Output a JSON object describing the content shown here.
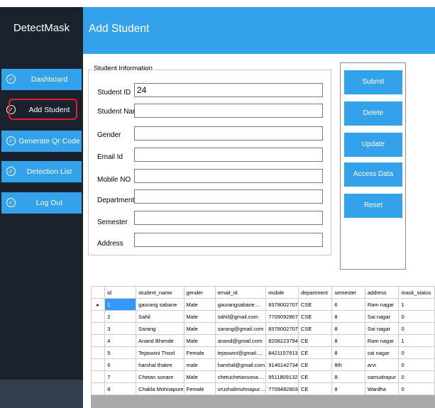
{
  "app": {
    "brand": "DetectMask",
    "page_title": "Add Student"
  },
  "sidebar": {
    "items": [
      {
        "label": "Dashboard",
        "icon": "check-circle-icon"
      },
      {
        "label": "Add Student",
        "icon": "check-circle-icon"
      },
      {
        "label": "Generate Qr Code",
        "icon": "check-circle-icon"
      },
      {
        "label": "Detection List",
        "icon": "check-circle-icon"
      },
      {
        "label": "Log Out",
        "icon": "check-circle-icon"
      }
    ],
    "active": "Add Student",
    "accent": "#33a2ea",
    "highlight_ring": "#e0212c"
  },
  "form": {
    "group_title": "Student Information",
    "fields": [
      {
        "label": "Student ID",
        "value": "24"
      },
      {
        "label": "Student Name",
        "value": ""
      },
      {
        "label": "Gender",
        "value": ""
      },
      {
        "label": "Email Id",
        "value": ""
      },
      {
        "label": "Mobile NO",
        "value": ""
      },
      {
        "label": "Department",
        "value": ""
      },
      {
        "label": "Semester",
        "value": ""
      },
      {
        "label": "Address",
        "value": ""
      }
    ]
  },
  "actions": {
    "submit": "Submit",
    "delete": "Delete",
    "update": "Update",
    "access": "Access Data",
    "reset": "Reset"
  },
  "grid": {
    "row_marker": "▸",
    "columns": [
      "id",
      "student_name",
      "gender",
      "email_id",
      "mobile",
      "department",
      "semester",
      "address",
      "mask_status"
    ],
    "rows": [
      [
        "1",
        "gaurang sabane",
        "Male",
        "gaurangsabane....",
        "8378002707",
        "CSE",
        "6",
        "Ram nagar",
        "1"
      ],
      [
        "2",
        "Sahil",
        "Male",
        "sahil@gmail.com",
        "7709092867",
        "CSE",
        "8",
        "Sai nagar",
        "0"
      ],
      [
        "3",
        "Sarang",
        "Male",
        "sarang@gmail.com",
        "8378002707",
        "CSE",
        "8",
        "Sai nagar",
        "0"
      ],
      [
        "4",
        "Anand Bhende",
        "Male",
        "anand@gmail.com",
        "8208223794",
        "CE",
        "8",
        "Ram nagar",
        "1"
      ],
      [
        "5",
        "Tejaswini Thool",
        "Female",
        "tejaswini@gmail....",
        "8421157913",
        "CE",
        "8",
        "sai nagar",
        "0"
      ],
      [
        "6",
        "harshal thakre",
        "male",
        "harshal@gmail.com",
        "9146142734",
        "CE",
        "8th",
        "arvi",
        "0"
      ],
      [
        "7",
        "Chetan sonare",
        "Male",
        "chetuchetansona....",
        "9511809132",
        "CE",
        "8",
        "samudrapur",
        "0"
      ],
      [
        "8",
        "Chakla Mohnapure",
        "Female",
        "vrushalimohnapur....",
        "7709482803",
        "CE",
        "8",
        "Wardha",
        "0"
      ]
    ]
  }
}
